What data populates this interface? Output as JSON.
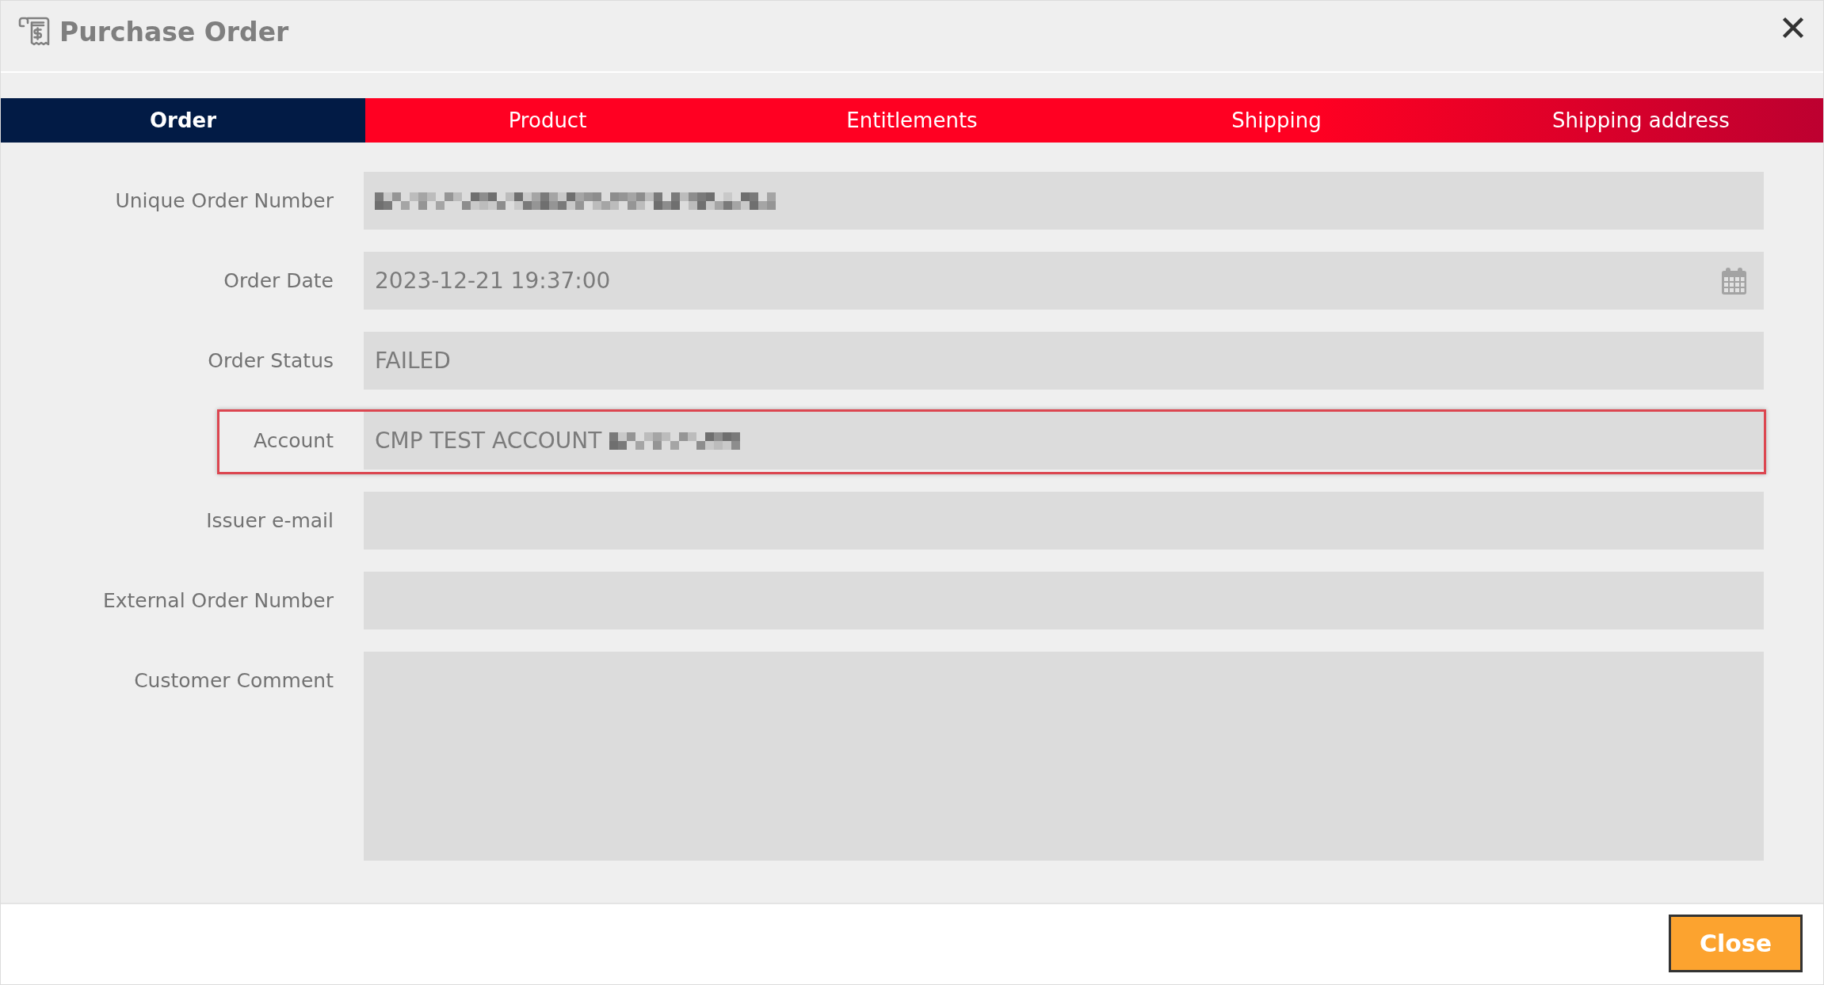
{
  "dialog": {
    "title": "Purchase Order"
  },
  "tabs": [
    {
      "label": "Order",
      "selected": true
    },
    {
      "label": "Product",
      "selected": false
    },
    {
      "label": "Entitlements",
      "selected": false
    },
    {
      "label": "Shipping",
      "selected": false
    },
    {
      "label": "Shipping address",
      "selected": false
    }
  ],
  "fields": [
    {
      "label": "Unique Order Number",
      "kind": "text",
      "redacted": true,
      "highlighted": false
    },
    {
      "label": "Order Date",
      "kind": "date",
      "value": "2023-12-21 19:37:00",
      "redacted": false,
      "highlighted": false
    },
    {
      "label": "Order Status",
      "kind": "text",
      "value": "FAILED",
      "redacted": false,
      "highlighted": false
    },
    {
      "label": "Account",
      "kind": "text",
      "value": "CMP TEST ACCOUNT",
      "redacted": true,
      "highlighted": true
    },
    {
      "label": "Issuer e-mail",
      "kind": "text",
      "redacted": false,
      "highlighted": false
    },
    {
      "label": "External Order Number",
      "kind": "text",
      "redacted": false,
      "highlighted": false
    },
    {
      "label": "Customer Comment",
      "kind": "textarea",
      "redacted": false,
      "highlighted": false
    }
  ],
  "footer": {
    "buttons": [
      "Close"
    ]
  }
}
